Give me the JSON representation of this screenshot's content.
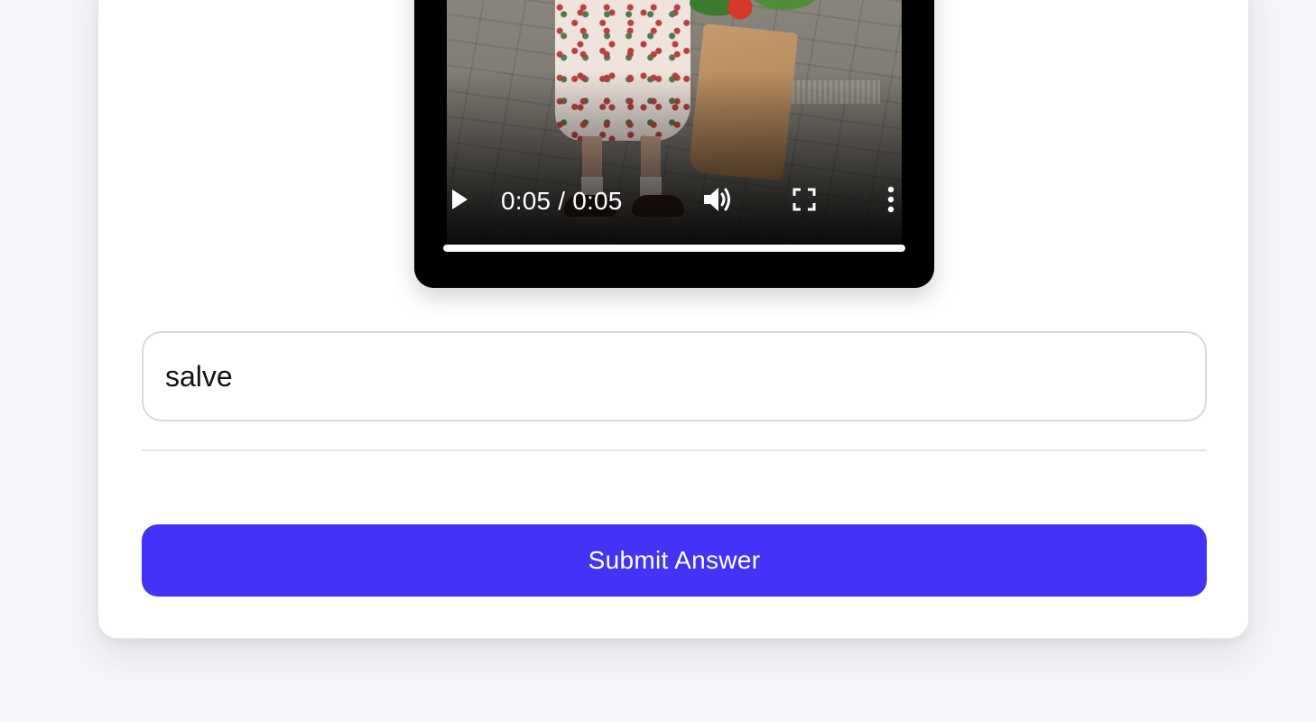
{
  "video": {
    "current_time": "0:05",
    "duration": "0:05",
    "time_display": "0:05 / 0:05",
    "progress_fraction": 1.0
  },
  "answer": {
    "value": "salve"
  },
  "submit": {
    "label": "Submit Answer"
  },
  "colors": {
    "accent": "#4332f7",
    "page_bg": "#f5f6f9",
    "card_bg": "#ffffff"
  },
  "icons": {
    "play": "play-icon",
    "volume": "volume-icon",
    "fullscreen": "fullscreen-icon",
    "more": "more-vertical-icon"
  }
}
